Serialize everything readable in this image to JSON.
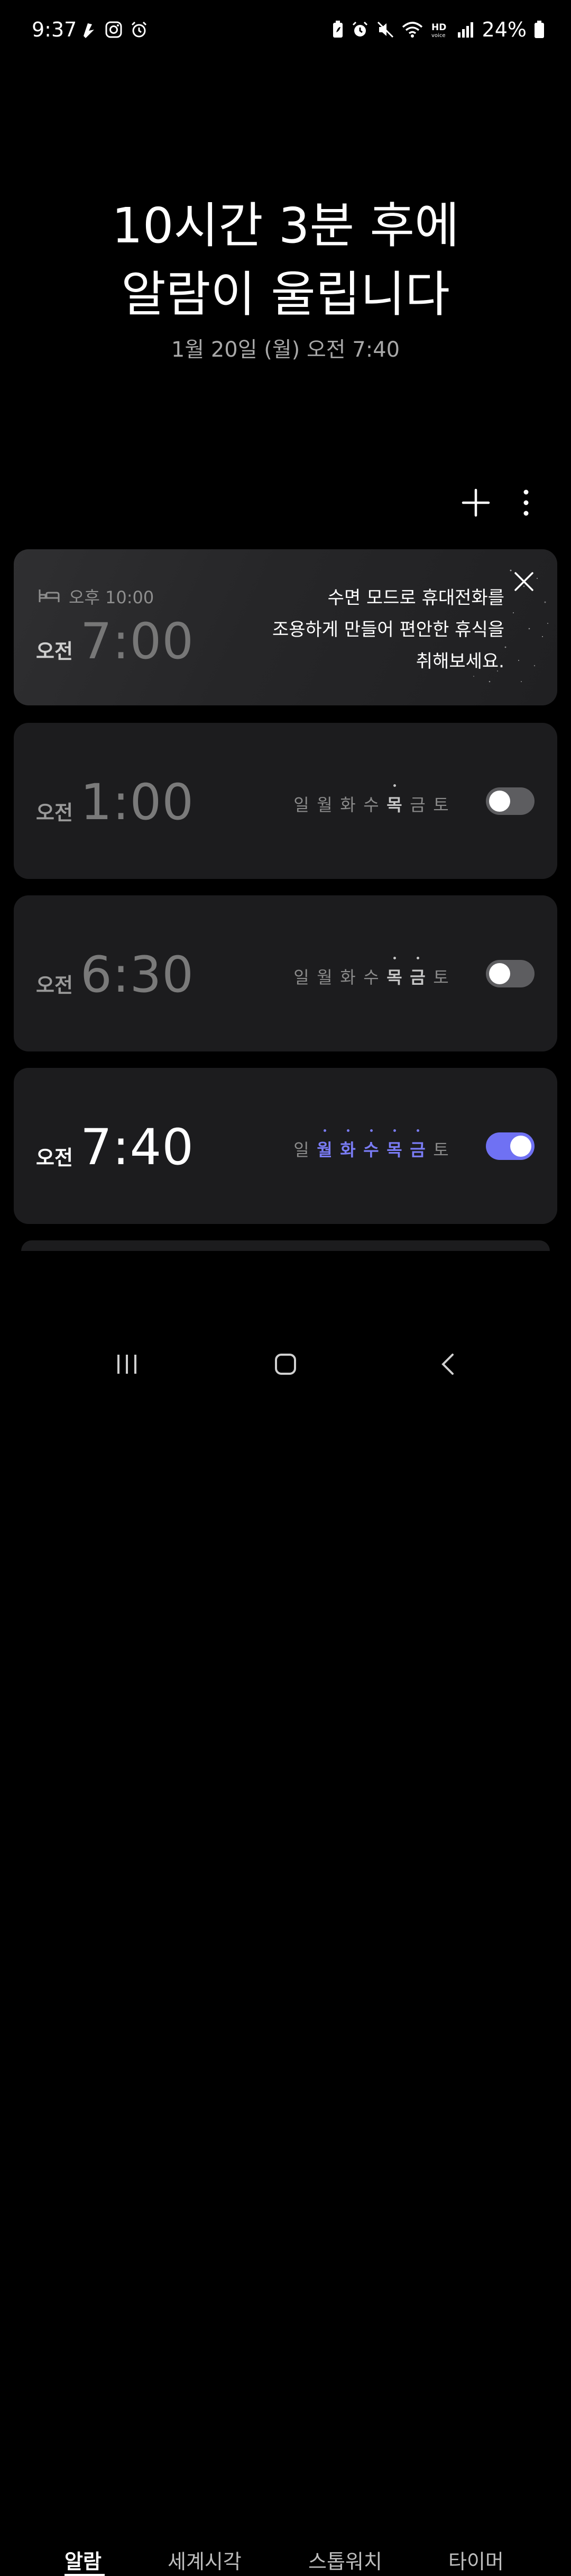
{
  "status_bar": {
    "time": "9:37",
    "battery_percent": "24%",
    "left_icons": [
      "app-notification-icon",
      "instagram-icon",
      "alarm-clock-icon"
    ],
    "right_icons": [
      "battery-saver-icon",
      "alarm-icon",
      "mute-icon",
      "wifi-icon",
      "hd-voice-icon",
      "signal-icon",
      "battery-icon"
    ]
  },
  "hero": {
    "line1": "10시간 3분 후에",
    "line2": "알람이 울립니다",
    "subtitle": "1월 20일 (월) 오전 7:40"
  },
  "toolbar": {
    "add_icon": "plus-icon",
    "more_icon": "more-vertical-icon"
  },
  "sleep_card": {
    "bedtime_label": "오후 10:00",
    "ampm": "오전",
    "time": "7:00",
    "message_line1": "수면 모드로 휴대전화를",
    "message_line2": "조용하게 만들어 편안한 휴식을",
    "message_line3": "취해보세요.",
    "close_icon": "close-icon",
    "bed_icon": "bed-icon"
  },
  "alarms": [
    {
      "ampm": "오전",
      "time": "1:00",
      "enabled": false,
      "days": [
        "일",
        "월",
        "화",
        "수",
        "목",
        "금",
        "토"
      ],
      "selected_days": [
        false,
        false,
        false,
        false,
        true,
        false,
        false
      ]
    },
    {
      "ampm": "오전",
      "time": "6:30",
      "enabled": false,
      "days": [
        "일",
        "월",
        "화",
        "수",
        "목",
        "금",
        "토"
      ],
      "selected_days": [
        false,
        false,
        false,
        false,
        true,
        true,
        false
      ]
    },
    {
      "ampm": "오전",
      "time": "7:40",
      "enabled": true,
      "days": [
        "일",
        "월",
        "화",
        "수",
        "목",
        "금",
        "토"
      ],
      "selected_days": [
        false,
        true,
        true,
        true,
        true,
        true,
        false
      ]
    }
  ],
  "bottom_nav": {
    "tabs": [
      "알람",
      "세계시각",
      "스톱워치",
      "타이머"
    ],
    "active_index": 0
  },
  "colors": {
    "accent": "#6f71f3",
    "accent_text": "#7a7cf5",
    "card_bg": "#1c1c1e",
    "background": "#000000"
  }
}
